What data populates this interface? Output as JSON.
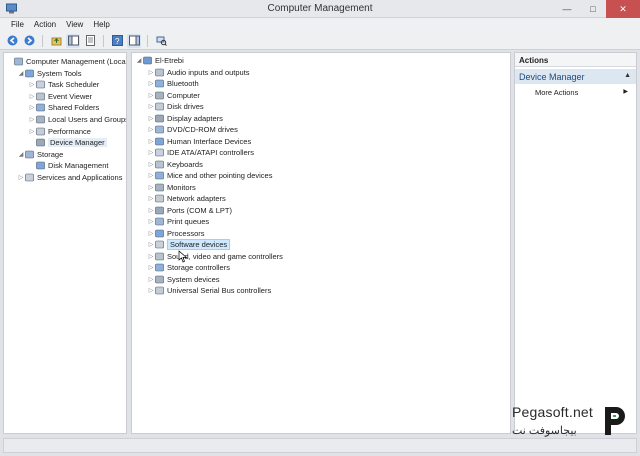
{
  "window": {
    "title": "Computer Management"
  },
  "menu": [
    "File",
    "Action",
    "View",
    "Help"
  ],
  "left_tree": [
    {
      "label": "Computer Management (Local",
      "level": 0,
      "expander": "",
      "icon": "computer-management-icon"
    },
    {
      "label": "System Tools",
      "level": 1,
      "expander": "expanded",
      "icon": "system-tools-icon"
    },
    {
      "label": "Task Scheduler",
      "level": 2,
      "expander": "collapsed",
      "icon": "clock-icon"
    },
    {
      "label": "Event Viewer",
      "level": 2,
      "expander": "collapsed",
      "icon": "event-viewer-icon"
    },
    {
      "label": "Shared Folders",
      "level": 2,
      "expander": "collapsed",
      "icon": "folder-icon"
    },
    {
      "label": "Local Users and Groups",
      "level": 2,
      "expander": "collapsed",
      "icon": "users-icon"
    },
    {
      "label": "Performance",
      "level": 2,
      "expander": "collapsed",
      "icon": "performance-icon"
    },
    {
      "label": "Device Manager",
      "level": 2,
      "expander": "",
      "icon": "device-manager-icon",
      "selected": true
    },
    {
      "label": "Storage",
      "level": 1,
      "expander": "expanded",
      "icon": "storage-icon"
    },
    {
      "label": "Disk Management",
      "level": 2,
      "expander": "",
      "icon": "disk-icon"
    },
    {
      "label": "Services and Applications",
      "level": 1,
      "expander": "collapsed",
      "icon": "services-icon"
    }
  ],
  "device_tree": {
    "root": {
      "label": "El-Etrebi",
      "icon": "computer-icon"
    },
    "items": [
      {
        "label": "Audio inputs and outputs",
        "icon": "audio-icon"
      },
      {
        "label": "Bluetooth",
        "icon": "bluetooth-icon"
      },
      {
        "label": "Computer",
        "icon": "computer-icon"
      },
      {
        "label": "Disk drives",
        "icon": "disk-drive-icon"
      },
      {
        "label": "Display adapters",
        "icon": "display-adapter-icon"
      },
      {
        "label": "DVD/CD-ROM drives",
        "icon": "dvd-icon"
      },
      {
        "label": "Human Interface Devices",
        "icon": "hid-icon"
      },
      {
        "label": "IDE ATA/ATAPI controllers",
        "icon": "ide-controller-icon"
      },
      {
        "label": "Keyboards",
        "icon": "keyboard-icon"
      },
      {
        "label": "Mice and other pointing devices",
        "icon": "mouse-icon"
      },
      {
        "label": "Monitors",
        "icon": "monitor-icon"
      },
      {
        "label": "Network adapters",
        "icon": "network-adapter-icon"
      },
      {
        "label": "Ports (COM & LPT)",
        "icon": "port-icon"
      },
      {
        "label": "Print queues",
        "icon": "printer-icon"
      },
      {
        "label": "Processors",
        "icon": "processor-icon"
      },
      {
        "label": "Software devices",
        "icon": "software-device-icon",
        "highlighted": true
      },
      {
        "label": "Sound, video and game controllers",
        "icon": "sound-icon"
      },
      {
        "label": "Storage controllers",
        "icon": "storage-controller-icon"
      },
      {
        "label": "System devices",
        "icon": "system-device-icon"
      },
      {
        "label": "Universal Serial Bus controllers",
        "icon": "usb-icon"
      }
    ]
  },
  "actions": {
    "header": "Actions",
    "section": "Device Manager",
    "links": [
      "More Actions"
    ]
  },
  "watermark": {
    "text": "Pegasoft.net",
    "arabic": "بيجاسوفت نت"
  }
}
